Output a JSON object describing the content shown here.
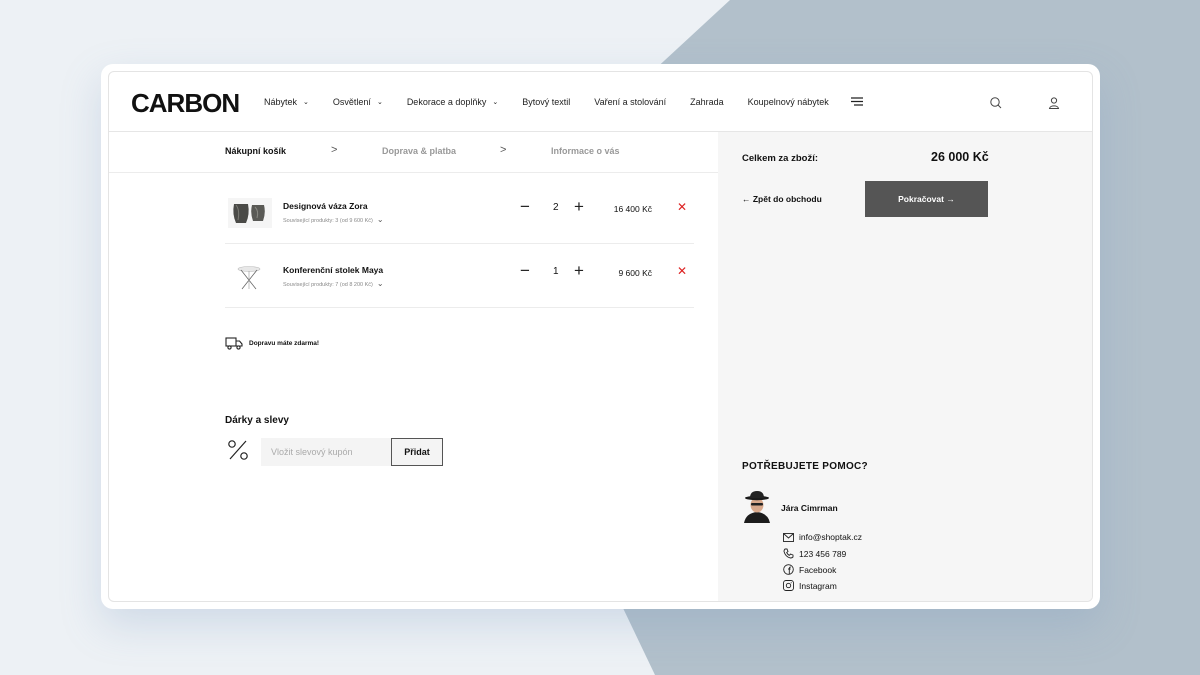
{
  "brand": {
    "logo": "CARBON"
  },
  "nav": {
    "items": [
      {
        "label": "Nábytek",
        "dropdown": true
      },
      {
        "label": "Osvětlení",
        "dropdown": true
      },
      {
        "label": "Dekorace a doplňky",
        "dropdown": true
      },
      {
        "label": "Bytový textil",
        "dropdown": false
      },
      {
        "label": "Vaření a stolování",
        "dropdown": false
      },
      {
        "label": "Zahrada",
        "dropdown": false
      },
      {
        "label": "Koupelnový nábytek",
        "dropdown": false
      }
    ],
    "icons": [
      "menu-icon",
      "search-icon",
      "user-icon"
    ]
  },
  "steps": {
    "cart": "Nákupní košík",
    "shipping": "Doprava & platba",
    "info": "Informace o vás",
    "separator": ">"
  },
  "cart": {
    "items": [
      {
        "name": "Designová váza Zora",
        "related": "Související produkty: 3 (od 9 600 Kč)",
        "quantity": "2",
        "price": "16 400 Kč"
      },
      {
        "name": "Konferenční stolek Maya",
        "related": "Související produkty: 7 (od 8 200 Kč)",
        "quantity": "1",
        "price": "9 600 Kč"
      }
    ],
    "minus": "−",
    "plus": "+",
    "remove": "✕",
    "free_shipping": "Dopravu máte zdarma!"
  },
  "gifts": {
    "title": "Dárky a slevy",
    "coupon_placeholder": "Vložit slevový kupón",
    "add_button": "Přidat"
  },
  "summary": {
    "total_label": "Celkem za zboží:",
    "total_value": "26 000 Kč",
    "back_link": "← Zpět do obchodu",
    "continue_button": "Pokračovat →"
  },
  "help": {
    "title": "POTŘEBUJETE POMOC?",
    "agent": "Jára Cimrman",
    "email": "info@shoptak.cz",
    "phone": "123 456 789",
    "facebook": "Facebook",
    "instagram": "Instagram"
  },
  "colors": {
    "background": "#edf1f5",
    "accent_shape": "#b0bfca",
    "button_dark": "#555555",
    "remove_red": "#dd2222",
    "panel": "#f6f6f6"
  }
}
